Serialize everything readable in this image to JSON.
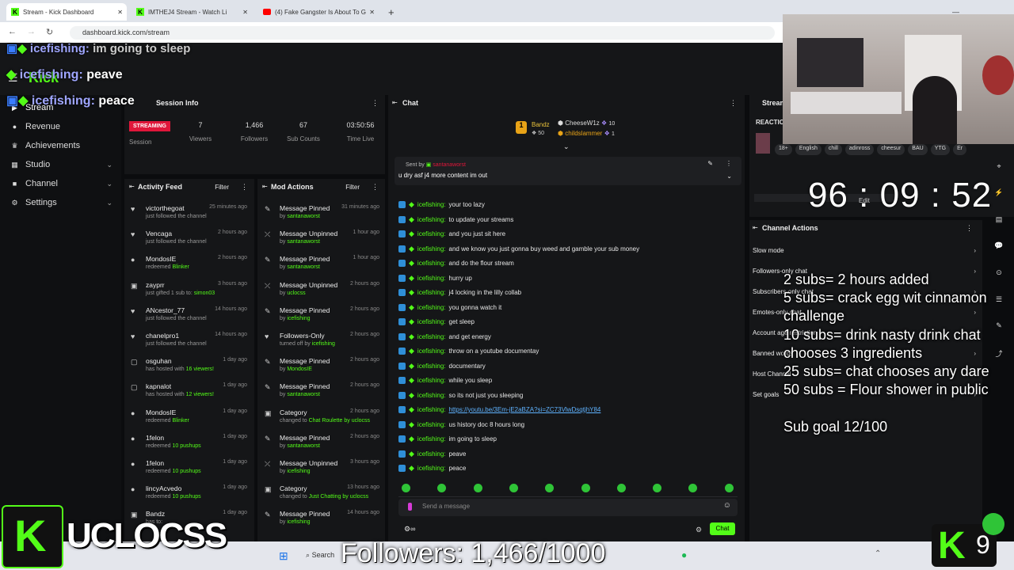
{
  "browser": {
    "tabs": [
      {
        "title": "Stream - Kick Dashboard"
      },
      {
        "title": "IMTHEJ4 Stream - Watch Li"
      },
      {
        "title": "(4) Fake Gangster Is About To G"
      }
    ],
    "url": "dashboard.kick.com/stream"
  },
  "overlay_chat": [
    {
      "user": "icefishing:",
      "msg": "im going to sleep"
    },
    {
      "user": "icefishing:",
      "msg": "peave"
    },
    {
      "user": "icefishing:",
      "msg": "peace"
    }
  ],
  "kick_logo": "Kick",
  "sidebar": {
    "items": [
      {
        "label": "Stream",
        "icon": "play-icon"
      },
      {
        "label": "Revenue",
        "icon": "coin-icon"
      },
      {
        "label": "Achievements",
        "icon": "trophy-icon"
      },
      {
        "label": "Studio",
        "icon": "studio-icon"
      },
      {
        "label": "Channel",
        "icon": "channel-icon"
      },
      {
        "label": "Settings",
        "icon": "gear-icon"
      }
    ]
  },
  "session": {
    "title": "Session Info",
    "badge": "STREAMING",
    "badge_label": "Session",
    "stats": [
      {
        "value": "7",
        "label": "Viewers"
      },
      {
        "value": "1,466",
        "label": "Followers"
      },
      {
        "value": "67",
        "label": "Sub Counts"
      },
      {
        "value": "03:50:56",
        "label": "Time Live"
      }
    ]
  },
  "activity": {
    "title": "Activity Feed",
    "filter": "Filter",
    "items": [
      {
        "name": "victorthegoat",
        "sub": "just followed the channel",
        "hl": "",
        "time": "25 minutes ago"
      },
      {
        "name": "Vencaga",
        "sub": "just followed the channel",
        "hl": "",
        "time": "2 hours ago"
      },
      {
        "name": "MondosIE",
        "sub": "redeemed ",
        "hl": "Blinker",
        "time": "2 hours ago"
      },
      {
        "name": "zayprr",
        "sub": "just gifted 1 sub to: ",
        "hl": "simon03",
        "time": "3 hours ago"
      },
      {
        "name": "ANcestor_77",
        "sub": "just followed the channel",
        "hl": "",
        "time": "14 hours ago"
      },
      {
        "name": "chanelpro1",
        "sub": "just followed the channel",
        "hl": "",
        "time": "14 hours ago"
      },
      {
        "name": "osguhan",
        "sub": "has hosted with ",
        "hl": "16 viewers!",
        "time": "1 day ago"
      },
      {
        "name": "kapnalot",
        "sub": "has hosted with ",
        "hl": "12 viewers!",
        "time": "1 day ago"
      },
      {
        "name": "MondosIE",
        "sub": "redeemed ",
        "hl": "Blinker",
        "time": "1 day ago"
      },
      {
        "name": "1felon",
        "sub": "redeemed ",
        "hl": "10 pushups",
        "time": "1 day ago"
      },
      {
        "name": "1felon",
        "sub": "redeemed ",
        "hl": "10 pushups",
        "time": "1 day ago"
      },
      {
        "name": "lincyAcvedo",
        "sub": "redeemed ",
        "hl": "10 pushups",
        "time": "1 day ago"
      },
      {
        "name": "Bandz",
        "sub": "has to:",
        "hl": "",
        "time": "1 day ago"
      }
    ]
  },
  "mod": {
    "title": "Mod Actions",
    "filter": "Filter",
    "items": [
      {
        "name": "Message Pinned",
        "sub": "by ",
        "hl": "santanaworst",
        "time": "31 minutes ago"
      },
      {
        "name": "Message Unpinned",
        "sub": "by ",
        "hl": "santanaworst",
        "time": "1 hour ago"
      },
      {
        "name": "Message Pinned",
        "sub": "by ",
        "hl": "santanaworst",
        "time": "1 hour ago"
      },
      {
        "name": "Message Unpinned",
        "sub": "by ",
        "hl": "uclocss",
        "time": "2 hours ago"
      },
      {
        "name": "Message Pinned",
        "sub": "by ",
        "hl": "icefishing",
        "time": "2 hours ago"
      },
      {
        "name": "Followers-Only",
        "sub": "turned off by ",
        "hl": "icefishing",
        "time": "2 hours ago"
      },
      {
        "name": "Message Pinned",
        "sub": "by ",
        "hl": "MondosIE",
        "time": "2 hours ago"
      },
      {
        "name": "Message Pinned",
        "sub": "by ",
        "hl": "santanaworst",
        "time": "2 hours ago"
      },
      {
        "name": "Category",
        "sub": "changed to ",
        "hl": "Chat Roulette",
        "extra": " by uclocss",
        "time": "2 hours ago"
      },
      {
        "name": "Message Pinned",
        "sub": "by ",
        "hl": "santanaworst",
        "time": "2 hours ago"
      },
      {
        "name": "Message Unpinned",
        "sub": "by ",
        "hl": "icefishing",
        "time": "3 hours ago"
      },
      {
        "name": "Category",
        "sub": "changed to ",
        "hl": "Just Chatting",
        "extra": " by uclocss",
        "time": "13 hours ago"
      },
      {
        "name": "Message Pinned",
        "sub": "by ",
        "hl": "icefishing",
        "time": "14 hours ago"
      }
    ]
  },
  "chat": {
    "title": "Chat",
    "leaders": [
      {
        "name": "Bandz",
        "count": "50"
      },
      {
        "name": "CheeseW1z",
        "count": "10"
      },
      {
        "name": "childslammer",
        "count": "1"
      }
    ],
    "pinned": {
      "by_label": "Sent by",
      "by": "santanaworst",
      "msg": "u dry asf j4 more content im out"
    },
    "messages": [
      {
        "user": "icefishing:",
        "msg": "your too lazy"
      },
      {
        "user": "icefishing:",
        "msg": "to update your streams"
      },
      {
        "user": "icefishing:",
        "msg": "and you just sit here"
      },
      {
        "user": "icefishing:",
        "msg": "and we know you just gonna buy weed and gamble your sub money"
      },
      {
        "user": "icefishing:",
        "msg": "and do the flour stream"
      },
      {
        "user": "icefishing:",
        "msg": "hurry up"
      },
      {
        "user": "icefishing:",
        "msg": "j4 locking in the lilly collab"
      },
      {
        "user": "icefishing:",
        "msg": "you gonna watch it"
      },
      {
        "user": "icefishing:",
        "msg": "get sleep"
      },
      {
        "user": "icefishing:",
        "msg": "and get energy"
      },
      {
        "user": "icefishing:",
        "msg": "throw on a youtube documentay"
      },
      {
        "user": "icefishing:",
        "msg": "documentary"
      },
      {
        "user": "icefishing:",
        "msg": "while you sleep"
      },
      {
        "user": "icefishing:",
        "msg": "so its not just you sleeping"
      },
      {
        "user": "icefishing:",
        "msg": "https://youtu.be/3Em-jE2aBZA?si=ZC73VlwDsqtjhY84",
        "link": true
      },
      {
        "user": "icefishing:",
        "msg": "us history doc 8 hours long"
      },
      {
        "user": "icefishing:",
        "msg": "im going to sleep"
      },
      {
        "user": "icefishing:",
        "msg": "peave"
      },
      {
        "user": "icefishing:",
        "msg": "peace"
      }
    ],
    "placeholder": "Send a message",
    "send": "Chat"
  },
  "stream_panel": {
    "title": "Stream",
    "reaction": "REACTIO",
    "tags": [
      "18+",
      "English",
      "chill",
      "adinross",
      "cheesur",
      "BAU",
      "YTG",
      "Er"
    ]
  },
  "timer": {
    "text": "96 : 09 : 52",
    "edit": "Edit"
  },
  "channel_actions": {
    "title": "Channel Actions",
    "items": [
      "Slow mode",
      "Followers-only chat",
      "Subscribers-only chat",
      "Emotes-only chat",
      "Account age restriction",
      "Banned words",
      "Host Channel",
      "Set goals"
    ]
  },
  "sub_overlay": {
    "lines": [
      "2 subs=  2 hours added",
      "5 subs= crack egg wit cinnamon",
      "challenge",
      "10 subs= drink nasty drink chat",
      "chooses 3 ingredients",
      "25 subs= chat chooses any dare",
      "50 subs = Flour shower in public"
    ],
    "goal": "Sub goal 12/100"
  },
  "followers_overlay": "Followers: 1,466/1000",
  "brand_overlay": "UCLOCSS",
  "k_badge": "9",
  "taskbar": {
    "search": "Search"
  },
  "colors": {
    "kick_green": "#53fc18",
    "streaming_red": "#e0163a",
    "panel_bg": "#151618"
  }
}
